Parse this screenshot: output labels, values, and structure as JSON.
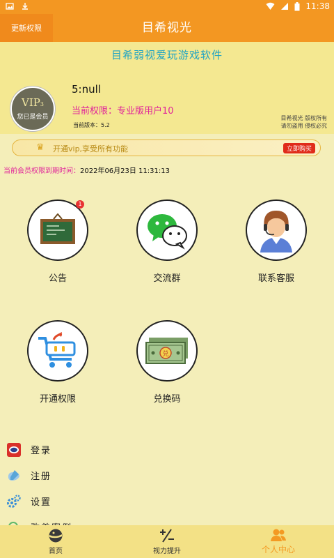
{
  "status": {
    "time": "11:38"
  },
  "appbar": {
    "back_label": "更新权限",
    "title": "目希视光"
  },
  "header": {
    "slogan": "目希弱视爱玩游戏软件",
    "avatar": {
      "vip_text": "VIP",
      "vip_level": "3",
      "member_text": "您已是会员"
    },
    "username": "5:null",
    "permission": "当前权限：专业版用户10",
    "version": "当前版本：5.2",
    "copyright": [
      "目希视光  版权所有",
      "请勿盗用  侵权必究"
    ]
  },
  "banner": {
    "text": "开通vip,享受所有功能",
    "buy_label": "立即购买"
  },
  "expiry": {
    "label": "当前会员权限到期时间：",
    "value": "2022年06月23日 11:31:13"
  },
  "features": [
    {
      "label": "公告",
      "icon": "blackboard-icon",
      "badge": "1"
    },
    {
      "label": "交流群",
      "icon": "wechat-icon"
    },
    {
      "label": "联系客服",
      "icon": "customer-service-icon"
    },
    {
      "label": "开通权限",
      "icon": "shopping-cart-icon"
    },
    {
      "label": "兑换码",
      "icon": "money-icon"
    }
  ],
  "menu": [
    {
      "label": "登录",
      "icon": "login-icon"
    },
    {
      "label": "注册",
      "icon": "register-icon"
    },
    {
      "label": "设置",
      "icon": "settings-icon"
    },
    {
      "label": "改善案例",
      "icon": "cases-icon"
    }
  ],
  "tabs": [
    {
      "label": "首页",
      "icon": "home-icon"
    },
    {
      "label": "视力提升",
      "icon": "vision-icon"
    },
    {
      "label": "个人中心",
      "icon": "profile-icon",
      "active": true
    }
  ],
  "colors": {
    "accent": "#f39722",
    "background": "#f4eeb9",
    "highlight": "#e0249a",
    "slogan": "#1ea3c4"
  }
}
